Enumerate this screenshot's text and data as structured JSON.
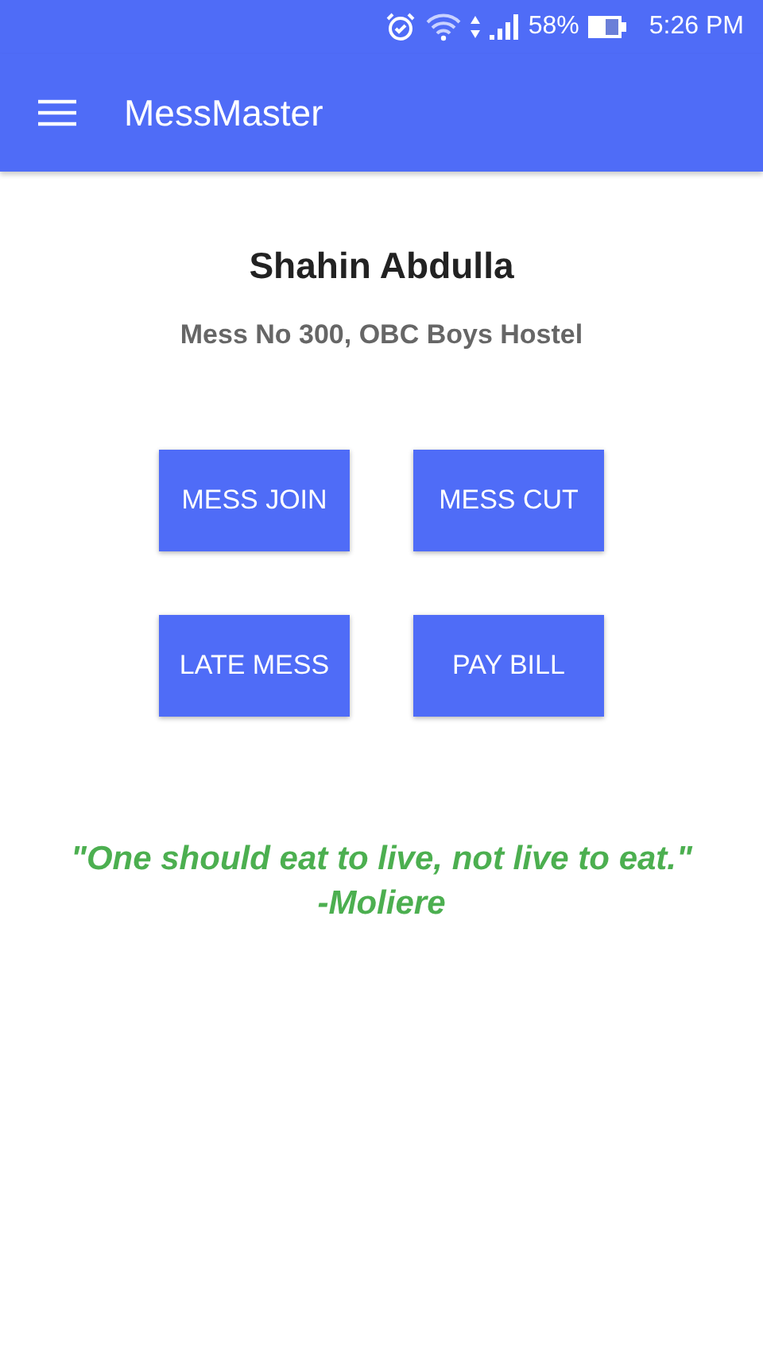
{
  "status_bar": {
    "battery": "58%",
    "time": "5:26 PM"
  },
  "app_bar": {
    "title": "MessMaster"
  },
  "profile": {
    "name": "Shahin Abdulla",
    "mess": "Mess No 300, OBC Boys Hostel"
  },
  "buttons": [
    "MESS JOIN",
    "MESS CUT",
    "LATE MESS",
    "PAY BILL"
  ],
  "quote": {
    "text": "\"One should eat to live, not live to eat.\"",
    "author": "-Moliere"
  }
}
